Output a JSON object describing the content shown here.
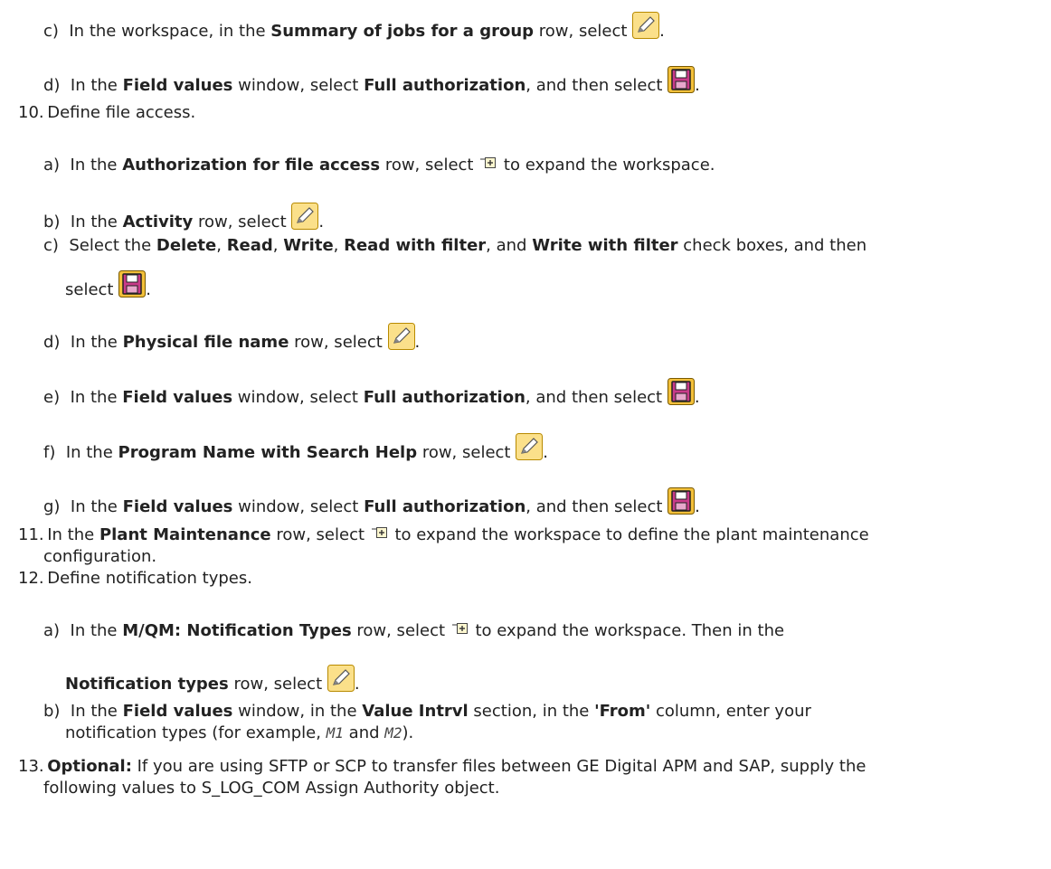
{
  "steps": {
    "c9": {
      "label": "c)",
      "pre": "In the workspace, in the ",
      "bold1": "Summary of jobs for a group",
      "post": " row, select ",
      "end": "."
    },
    "d9": {
      "label": "d)",
      "pre": "In the ",
      "bold1": "Field values",
      "mid": " window, select ",
      "bold2": "Full authorization",
      "post": ", and then select ",
      "end": "."
    },
    "s10": {
      "num": "10.",
      "text": "Define file access."
    },
    "a10": {
      "label": "a)",
      "pre": "In the ",
      "bold1": "Authorization for file access",
      "mid": " row, select ",
      "post": " to expand the workspace."
    },
    "b10": {
      "label": "b)",
      "pre": "In the ",
      "bold1": "Activity",
      "post": " row, select ",
      "end": "."
    },
    "c10": {
      "label": "c)",
      "pre": "Select the ",
      "b1": "Delete",
      "s1": ", ",
      "b2": "Read",
      "s2": ", ",
      "b3": "Write",
      "s3": ", ",
      "b4": "Read with filter",
      "s4": ", and ",
      "b5": "Write with filter",
      "s5": " check boxes, and then",
      "line2": "select ",
      "end": "."
    },
    "d10": {
      "label": "d)",
      "pre": "In the ",
      "bold1": "Physical file name",
      "post": " row, select ",
      "end": "."
    },
    "e10": {
      "label": "e)",
      "pre": "In the ",
      "bold1": "Field values",
      "mid": " window, select ",
      "bold2": "Full authorization",
      "post": ", and then select ",
      "end": "."
    },
    "f10": {
      "label": "f)",
      "pre": "In the ",
      "bold1": "Program Name with Search Help",
      "post": " row, select ",
      "end": "."
    },
    "g10": {
      "label": "g)",
      "pre": "In the ",
      "bold1": "Field values",
      "mid": " window, select ",
      "bold2": "Full authorization",
      "post": ", and then select ",
      "end": "."
    },
    "s11": {
      "num": "11.",
      "pre": "In the ",
      "bold1": "Plant Maintenance",
      "mid": " row, select ",
      "post": " to expand the workspace to define the plant maintenance",
      "line2": "configuration."
    },
    "s12": {
      "num": "12.",
      "text": "Define notification types."
    },
    "a12": {
      "label": "a)",
      "pre": "In the ",
      "bold1": "M/QM: Notification Types",
      "mid": " row, select ",
      "post": " to expand the workspace. Then in the",
      "bold2": "Notification types",
      "post2": " row, select ",
      "end": "."
    },
    "b12": {
      "label": "b)",
      "pre": "In the ",
      "bold1": "Field values",
      "mid": " window, in the ",
      "bold2": "Value Intrvl",
      "mid2": " section, in the ",
      "bold3": "'From'",
      "post": " column, enter your",
      "line2a": "notification types (for example, ",
      "code1": "M1",
      "line2b": " and ",
      "code2": "M2",
      "line2c": ")."
    },
    "s13": {
      "num": "13.",
      "bold1": "Optional:",
      "post": " If you are using SFTP or SCP to transfer files between GE Digital APM and SAP, supply the",
      "line2": "following values to S_LOG_COM Assign Authority object."
    }
  }
}
